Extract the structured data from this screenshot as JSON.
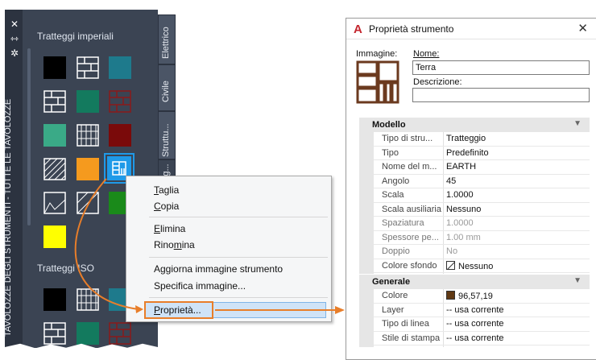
{
  "palette": {
    "title": "TAVOLOZZE DEGLI STRUMENTI - TUTTE LE TAVOLOZZE",
    "group1": "Tratteggi imperiali",
    "group2": "Tratteggi ISO",
    "tabs": [
      "Elettrico",
      "Civile",
      "Struttu...",
      "Tratteg..."
    ],
    "colors": {
      "bg": "#3b4453",
      "black": "#000000",
      "teal": "#1e7a8c",
      "green": "#137a5e",
      "sea_green": "#3aaa87",
      "dark_red": "#7a0a0a",
      "orange": "#f59a1e",
      "blue": "#1f9ae8",
      "bright_green": "#1a8a1a",
      "yellow": "#ffff00"
    }
  },
  "context_menu": {
    "items": [
      {
        "pre": "",
        "u": "T",
        "post": "aglia"
      },
      {
        "pre": "",
        "u": "C",
        "post": "opia"
      },
      {
        "pre": "",
        "u": "E",
        "post": "limina"
      },
      {
        "pre": "Rino",
        "u": "m",
        "post": "ina"
      },
      {
        "pre": "Aggiorna immagine strumento",
        "u": "",
        "post": ""
      },
      {
        "pre": "Specifica immagine...",
        "u": "",
        "post": ""
      },
      {
        "pre": "",
        "u": "P",
        "post": "roprietà..."
      }
    ],
    "highlight_color": "#e87e2a"
  },
  "dialog": {
    "title": "Proprietà strumento",
    "close_glyph": "✕",
    "image_label": "Immagine:",
    "name_label": "Nome:",
    "name_value": "Terra",
    "desc_label": "Descrizione:",
    "desc_value": "",
    "sections": {
      "modello": "Modello",
      "generale": "Generale"
    },
    "modello_rows": [
      {
        "name": "Tipo di stru...",
        "value": "Tratteggio",
        "disabled": false
      },
      {
        "name": "Tipo",
        "value": "Predefinito",
        "disabled": false
      },
      {
        "name": "Nome del m...",
        "value": "EARTH",
        "disabled": false
      },
      {
        "name": "Angolo",
        "value": "45",
        "disabled": false
      },
      {
        "name": "Scala",
        "value": "1.0000",
        "disabled": false
      },
      {
        "name": "Scala ausiliaria",
        "value": "Nessuno",
        "disabled": false
      },
      {
        "name": "Spaziatura",
        "value": "1.0000",
        "disabled": true
      },
      {
        "name": "Spessore pe...",
        "value": "1.00 mm",
        "disabled": true
      },
      {
        "name": "Doppio",
        "value": "No",
        "disabled": true
      },
      {
        "name": "Colore sfondo",
        "value": "Nessuno",
        "disabled": false
      }
    ],
    "generale_rows": [
      {
        "name": "Colore",
        "value": "96,57,19"
      },
      {
        "name": "Layer",
        "value": "-- usa corrente"
      },
      {
        "name": "Tipo di linea",
        "value": "-- usa corrente"
      },
      {
        "name": "Stile di stampa",
        "value": "-- usa corrente"
      }
    ],
    "color_swatch": "#60391300"
  }
}
